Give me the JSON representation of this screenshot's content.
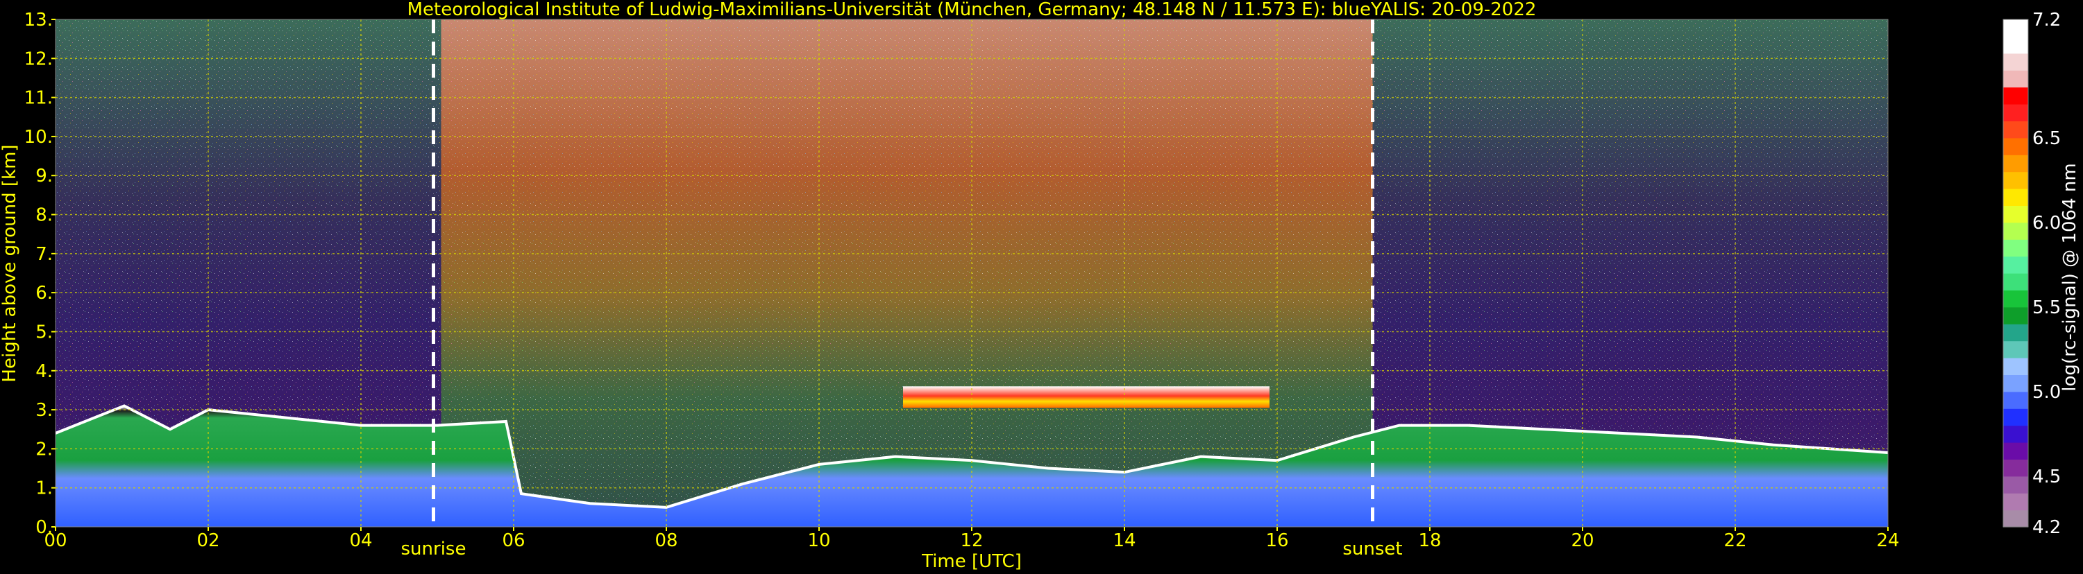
{
  "chart_data": {
    "type": "heatmap",
    "title": "Meteorological Institute of Ludwig-Maximilians-Universität (München, Germany; 48.148 N / 11.573 E):     blueYALIS: 20-09-2022",
    "xlabel": "Time [UTC]",
    "ylabel": "Height above ground [km]",
    "xlim": [
      0,
      24
    ],
    "ylim": [
      0,
      13
    ],
    "x_ticks": [
      {
        "value": 0,
        "label": "00"
      },
      {
        "value": 2,
        "label": "02"
      },
      {
        "value": 4,
        "label": "04"
      },
      {
        "value": 6,
        "label": "06"
      },
      {
        "value": 8,
        "label": "08"
      },
      {
        "value": 10,
        "label": "10"
      },
      {
        "value": 12,
        "label": "12"
      },
      {
        "value": 14,
        "label": "14"
      },
      {
        "value": 16,
        "label": "16"
      },
      {
        "value": 18,
        "label": "18"
      },
      {
        "value": 20,
        "label": "20"
      },
      {
        "value": 22,
        "label": "22"
      },
      {
        "value": 24,
        "label": "24"
      }
    ],
    "y_ticks": [
      {
        "value": 0,
        "label": "0."
      },
      {
        "value": 1,
        "label": "1."
      },
      {
        "value": 2,
        "label": "2."
      },
      {
        "value": 3,
        "label": "3."
      },
      {
        "value": 4,
        "label": "4."
      },
      {
        "value": 5,
        "label": "5."
      },
      {
        "value": 6,
        "label": "6."
      },
      {
        "value": 7,
        "label": "7."
      },
      {
        "value": 8,
        "label": "8."
      },
      {
        "value": 9,
        "label": "9."
      },
      {
        "value": 10,
        "label": "10."
      },
      {
        "value": 11,
        "label": "11."
      },
      {
        "value": 12,
        "label": "12."
      },
      {
        "value": 13,
        "label": "13."
      }
    ],
    "grid": true,
    "annotations": [
      {
        "label": "sunrise",
        "x": 4.95
      },
      {
        "label": "sunset",
        "x": 17.25
      }
    ],
    "colorbar": {
      "label": "log(rc-signal) @ 1064 nm",
      "range": [
        4.2,
        7.2
      ],
      "ticks": [
        {
          "value": 4.2,
          "label": "4.2"
        },
        {
          "value": 4.5,
          "label": "4.5"
        },
        {
          "value": 5.0,
          "label": "5.0"
        },
        {
          "value": 5.5,
          "label": "5.5"
        },
        {
          "value": 6.0,
          "label": "6.0"
        },
        {
          "value": 6.5,
          "label": "6.5"
        },
        {
          "value": 7.2,
          "label": "7.2"
        }
      ],
      "colors": [
        "#a88ca8",
        "#b07bb0",
        "#9a5aa6",
        "#862c9c",
        "#6a0ca8",
        "#3a10d0",
        "#2030ff",
        "#4a6cff",
        "#7aa2ff",
        "#9ec4ff",
        "#5ec7b8",
        "#23a58a",
        "#0e9e2a",
        "#18c43a",
        "#3de07a",
        "#56f0a0",
        "#80ff80",
        "#b4ff50",
        "#e6ff2c",
        "#ffe800",
        "#ffc000",
        "#ff9c00",
        "#ff7000",
        "#ff4a1a",
        "#ff2020",
        "#ff0000",
        "#f0b8b8",
        "#f4d4d4",
        "#ffffff",
        "#ffffff"
      ]
    },
    "features": {
      "boundary_layer": [
        {
          "x": 0.0,
          "h": 2.4
        },
        {
          "x": 0.9,
          "h": 3.1
        },
        {
          "x": 1.5,
          "h": 2.5
        },
        {
          "x": 2.0,
          "h": 3.0
        },
        {
          "x": 3.0,
          "h": 2.8
        },
        {
          "x": 4.0,
          "h": 2.6
        },
        {
          "x": 5.0,
          "h": 2.6
        },
        {
          "x": 5.9,
          "h": 2.7
        },
        {
          "x": 6.1,
          "h": 0.85
        },
        {
          "x": 7.0,
          "h": 0.6
        },
        {
          "x": 8.0,
          "h": 0.5
        },
        {
          "x": 9.0,
          "h": 1.1
        },
        {
          "x": 10.0,
          "h": 1.6
        },
        {
          "x": 11.0,
          "h": 1.8
        },
        {
          "x": 12.0,
          "h": 1.7
        },
        {
          "x": 13.0,
          "h": 1.5
        },
        {
          "x": 14.0,
          "h": 1.4
        },
        {
          "x": 15.0,
          "h": 1.8
        },
        {
          "x": 16.0,
          "h": 1.7
        },
        {
          "x": 17.0,
          "h": 2.3
        },
        {
          "x": 17.6,
          "h": 2.6
        },
        {
          "x": 18.5,
          "h": 2.6
        },
        {
          "x": 19.5,
          "h": 2.5
        },
        {
          "x": 20.5,
          "h": 2.4
        },
        {
          "x": 21.5,
          "h": 2.3
        },
        {
          "x": 22.5,
          "h": 2.1
        },
        {
          "x": 24.0,
          "h": 1.9
        }
      ],
      "cloud_layer": [
        {
          "x_start": 11.1,
          "x_end": 15.9,
          "bottom": 3.05,
          "top": 3.6
        }
      ]
    }
  }
}
